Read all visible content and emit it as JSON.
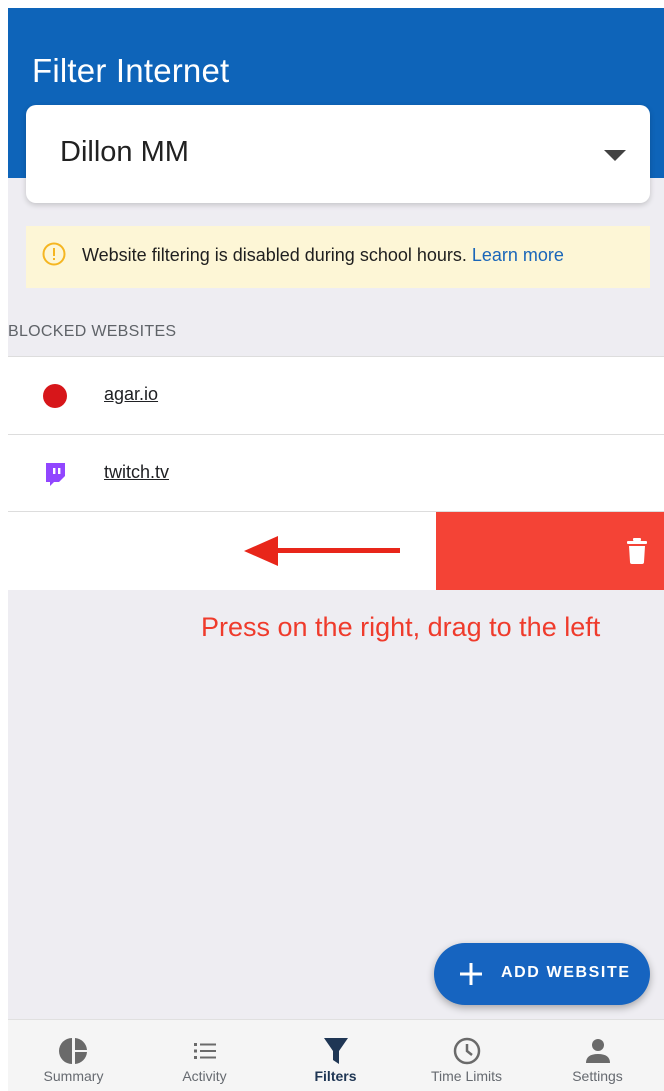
{
  "header": {
    "title": "Filter Internet"
  },
  "child_select": {
    "selected": "Dillon MM"
  },
  "notice": {
    "text": "Website filtering is disabled during school hours.",
    "link": "Learn more",
    "icon": "warning-circle-icon",
    "color": "#fdf6d6"
  },
  "section": {
    "label": "BLOCKED WEBSITES"
  },
  "sites": [
    {
      "label": "agar.io",
      "icon": "agario-icon"
    },
    {
      "label": "twitch.tv",
      "icon": "twitch-icon"
    }
  ],
  "swipe": {
    "instruction": "Press on the right, drag to the left",
    "delete_icon": "trash-icon"
  },
  "fab": {
    "label": "ADD WEBSITE",
    "icon": "plus-icon"
  },
  "nav": {
    "items": [
      {
        "label": "Summary",
        "icon": "pie-chart-icon"
      },
      {
        "label": "Activity",
        "icon": "list-icon"
      },
      {
        "label": "Filters",
        "icon": "filter-icon",
        "active": true
      },
      {
        "label": "Time Limits",
        "icon": "clock-icon"
      },
      {
        "label": "Settings",
        "icon": "person-icon"
      }
    ]
  },
  "colors": {
    "brand": "#0e64b9",
    "delete": "#f44336",
    "fab": "#1664c0",
    "instruction": "#ef3b2c"
  }
}
